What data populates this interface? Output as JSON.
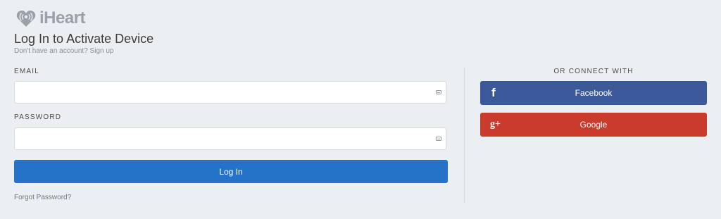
{
  "brand": {
    "name": "iHeart",
    "logo_color": "#9aa1a8"
  },
  "header": {
    "title": "Log In to Activate Device",
    "subtitle_prefix": "Don't have an account?",
    "signup_link": "Sign up"
  },
  "form": {
    "email_label": "EMAIL",
    "email_value": "",
    "password_label": "PASSWORD",
    "password_value": "",
    "login_button": "Log In",
    "forgot_link": "Forgot Password?"
  },
  "social": {
    "heading": "OR CONNECT WITH",
    "facebook": {
      "label": "Facebook",
      "icon": "facebook-icon",
      "glyph": "f",
      "color": "#3b5998"
    },
    "google": {
      "label": "Google",
      "icon": "google-plus-icon",
      "glyph": "g+",
      "color": "#c93c2d"
    }
  },
  "colors": {
    "background": "#eceff2",
    "primary_button": "#2473c9"
  }
}
